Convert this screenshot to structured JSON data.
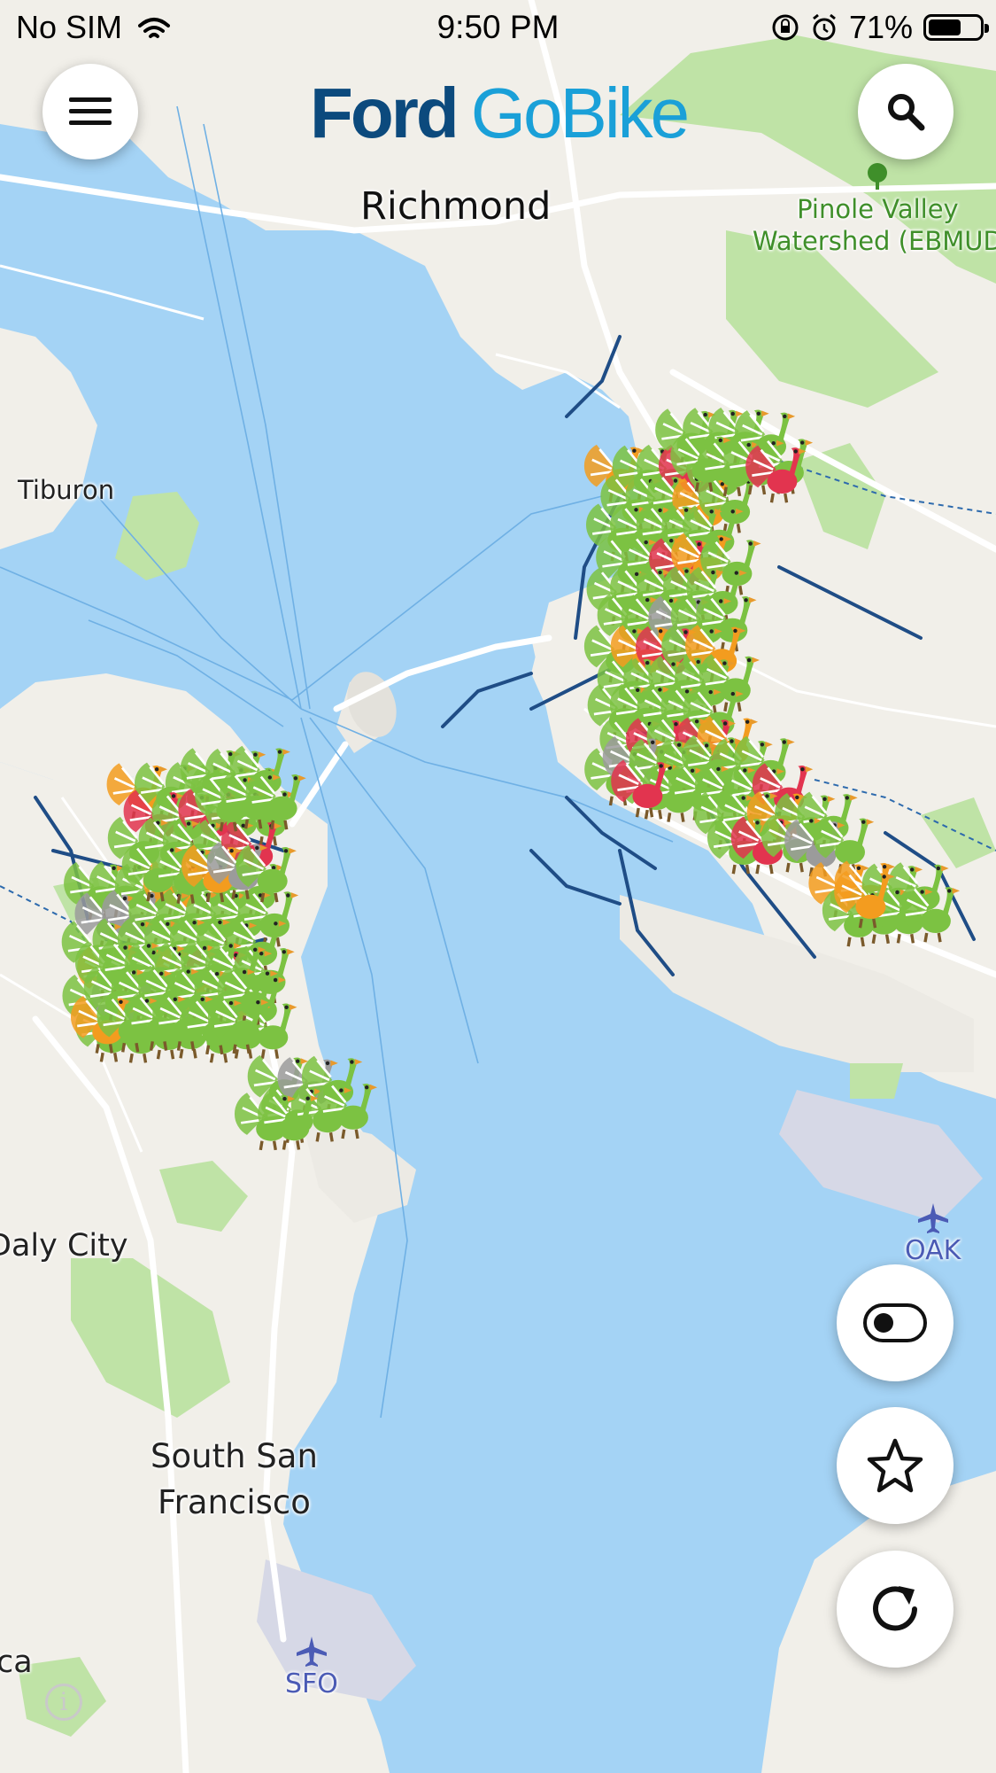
{
  "status_bar": {
    "carrier": "No SIM",
    "time": "9:50 PM",
    "battery_percent": "71%",
    "battery_level": 0.71,
    "icons": [
      "wifi-icon",
      "rotation-lock-icon",
      "alarm-icon",
      "battery-icon"
    ]
  },
  "header": {
    "logo_part1": "Ford",
    "logo_part2": "GoBike",
    "menu_icon": "hamburger-menu-icon",
    "search_icon": "search-icon"
  },
  "map": {
    "labels": {
      "richmond": "Richmond",
      "pinole_line1": "Pinole Valley",
      "pinole_line2": "Watershed (EBMUD",
      "tiburon": "Tiburon",
      "daly_city": "Daly City",
      "ssf_line1": "South San",
      "ssf_line2": "Francisco",
      "sfo": "SFO",
      "oak": "OAK",
      "ca": "ca"
    },
    "marker_icon": "turkey-icon",
    "marker_colors": {
      "available": "#7cc242",
      "low": "#f39c1f",
      "empty": "#e2344f",
      "inactive": "#9b9b9b"
    },
    "colors": {
      "water": "#a4d3f5",
      "land": "#f1efe9",
      "park": "#bfe3a6",
      "road": "#ffffff",
      "bike_lane": "#1f4d86"
    },
    "attribution_icon": "info-icon"
  },
  "controls": {
    "toggle_icon": "toggle-switch-icon",
    "favorite_icon": "star-outline-icon",
    "refresh_icon": "refresh-icon"
  }
}
